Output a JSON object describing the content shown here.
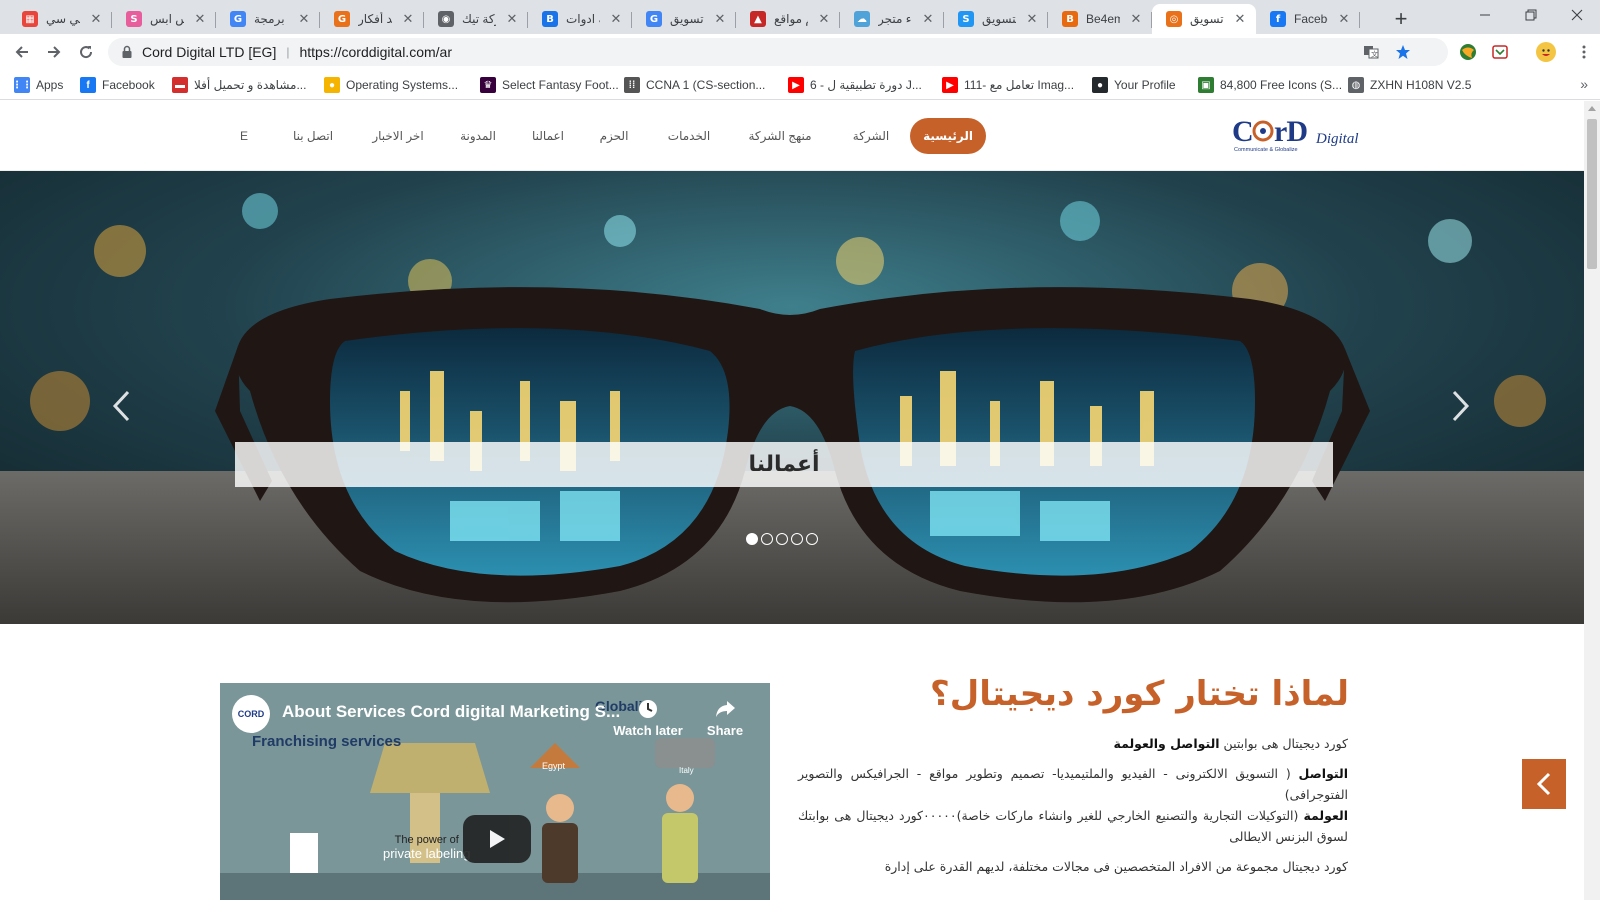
{
  "browser": {
    "tabs": [
      {
        "title": "اي بي سي",
        "color": "#e8453c",
        "glyph": "▦"
      },
      {
        "title": "اكس ابس",
        "color": "#e85d9b",
        "glyph": "S"
      },
      {
        "title": "شركة برمجة",
        "color": "#4285f4",
        "glyph": "G"
      },
      {
        "title": "جراند أفكار",
        "color": "#e8711a",
        "glyph": "G"
      },
      {
        "title": "شركة تيك",
        "color": "#5f6368",
        "glyph": "◉"
      },
      {
        "title": "شركة ادوات",
        "color": "#1a73e8",
        "glyph": "B"
      },
      {
        "title": "وكالة تسويق",
        "color": "#4285f4",
        "glyph": "G"
      },
      {
        "title": "تصميم مواقع",
        "color": "#c62828",
        "glyph": "▲"
      },
      {
        "title": "انشاء متجر",
        "color": "#4fa3d8",
        "glyph": "☁"
      },
      {
        "title": "خدمات التسويق",
        "color": "#2196f3",
        "glyph": "S"
      },
      {
        "title": "Be4em",
        "color": "#e86a10",
        "glyph": "B"
      },
      {
        "title": "شركة تسويق",
        "color": "#e8711a",
        "glyph": "◎"
      },
      {
        "title": "Facebook",
        "color": "#1877f2",
        "glyph": "f"
      }
    ],
    "active_tab_index": 11,
    "omnibox": {
      "site": "Cord Digital LTD [EG]",
      "url": "https://corddigital.com/ar"
    },
    "bookmarks": [
      {
        "label": "Apps",
        "icon": "apps-grid-icon",
        "color": "#4285f4"
      },
      {
        "label": "Facebook",
        "icon": "facebook-icon",
        "color": "#1877f2"
      },
      {
        "label": "مشاهدة و تحميل أفلا...",
        "icon": "movie-site-icon",
        "color": "#d32f2f"
      },
      {
        "label": "Operating Systems...",
        "icon": "os-icon",
        "color": "#f5b400"
      },
      {
        "label": "Select Fantasy Foot...",
        "icon": "fantasy-football-icon",
        "color": "#37003c"
      },
      {
        "label": "CCNA 1 (CS-section...",
        "icon": "ccna-icon",
        "color": "#555555"
      },
      {
        "label": "6 - دورة تطبيقية ل J...",
        "icon": "youtube-icon",
        "color": "#ff0000"
      },
      {
        "label": "111- تعامل مع Imag...",
        "icon": "youtube-icon",
        "color": "#ff0000"
      },
      {
        "label": "Your Profile",
        "icon": "github-icon",
        "color": "#24292e"
      },
      {
        "label": "84,800 Free Icons (S...",
        "icon": "icons-site-icon",
        "color": "#2e7d32"
      },
      {
        "label": "ZXHN H108N V2.5",
        "icon": "router-globe-icon",
        "color": "#5f6368"
      }
    ]
  },
  "site": {
    "nav": [
      {
        "label": "الرئيسية",
        "active": true
      },
      {
        "label": "الشركة"
      },
      {
        "label": "منهج الشركة"
      },
      {
        "label": "الخدمات"
      },
      {
        "label": "الحزم"
      },
      {
        "label": "اعمالنا"
      },
      {
        "label": "المدونة"
      },
      {
        "label": "اخر الاخبار"
      },
      {
        "label": "اتصل بنا"
      },
      {
        "label": "E"
      }
    ],
    "logo": {
      "main": "CorD",
      "sub": "Digital",
      "tagline": "Communicate & Globalize"
    },
    "hero": {
      "caption": "أعمالنا",
      "slide_count": 5,
      "active_slide": 0
    },
    "why": {
      "title": "لماذا تختار كورد ديجيتال؟",
      "intro_prefix": "كورد ديجيتال هى بوابتين ",
      "intro_bold": "التواصل والعولمة",
      "p2_bold": "التواصل",
      "p2_text": " ( التسويق الالكترونى - الفيديو والملتيميديا- تصميم وتطوير مواقع - الجرافيكس والتصوير الفتوجرافى)",
      "p3_bold": "العولمة",
      "p3_text": " (التوكيلات التجارية والتصنيع الخارجي للغير وانشاء ماركات خاصة)٠٠٠٠٠كورد ديجيتال هى بوابتك لسوق البزنس الايطالى",
      "p4_text": "كورد ديجيتال مجموعة من الافراد المتخصصين فى مجالات مختلفة، لديهم القدرة على إدارة"
    },
    "video": {
      "channel": "CORD",
      "title": "About Services Cord digital Marketing S...",
      "subtitle": "Franchising services",
      "watch_later": "Watch later",
      "share": "Share",
      "scene_text_1": "The power of",
      "scene_text_2": "private labeling",
      "label_egypt": "Egypt",
      "label_italy": "Italy",
      "label_global": "Globali"
    }
  }
}
